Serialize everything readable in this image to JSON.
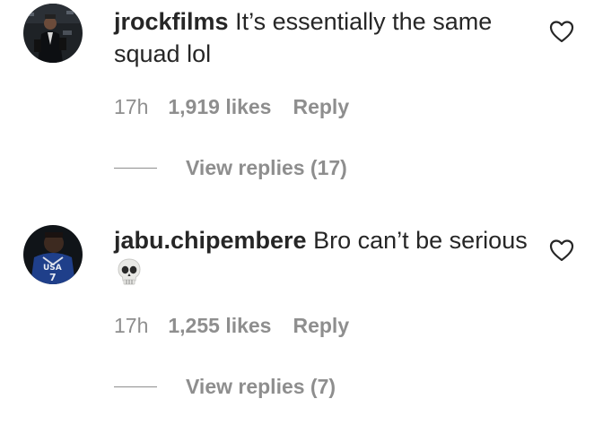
{
  "comments": [
    {
      "username": "jrockfilms",
      "text": "It’s essentially the same squad lol",
      "time": "17h",
      "likes": "1,919 likes",
      "reply_label": "Reply",
      "view_replies": "View replies (17)",
      "avatar_icon": "user-photo-avatar",
      "like_icon": "heart-outline-icon"
    },
    {
      "username": "jabu.chipembere",
      "text": "Bro can’t be serious",
      "emoji_icon": "skull-emoji-icon",
      "avatar_jersey_text": "USA",
      "avatar_jersey_number": "7",
      "time": "17h",
      "likes": "1,255 likes",
      "reply_label": "Reply",
      "view_replies": "View replies (7)",
      "avatar_icon": "user-photo-avatar",
      "like_icon": "heart-outline-icon"
    }
  ],
  "colors": {
    "text_primary": "#262626",
    "text_secondary": "#8e8e8e",
    "background": "#ffffff"
  }
}
